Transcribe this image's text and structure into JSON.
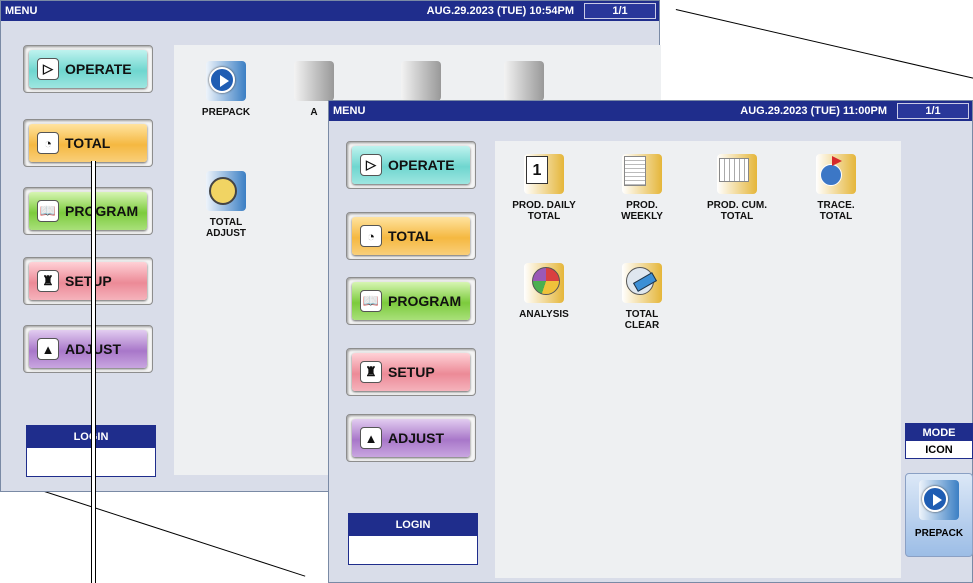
{
  "back_screen": {
    "menu_label": "MENU",
    "datetime": "AUG.29.2023 (TUE) 10:54PM",
    "page": "1/1",
    "nav": [
      {
        "label": "OPERATE",
        "icon": "operate-icon"
      },
      {
        "label": "TOTAL",
        "icon": "total-icon"
      },
      {
        "label": "PROGRAM",
        "icon": "program-icon"
      },
      {
        "label": "SETUP",
        "icon": "setup-icon"
      },
      {
        "label": "ADJUST",
        "icon": "adjust-icon"
      }
    ],
    "login_label": "LOGIN",
    "tiles": [
      {
        "label": "PREPACK",
        "icon": "prepack-icon"
      },
      {
        "label": "A",
        "icon": "trash-icon"
      },
      {
        "label": "TOTAL ADJUST",
        "icon": "total-adjust-icon"
      }
    ]
  },
  "front_screen": {
    "menu_label": "MENU",
    "datetime": "AUG.29.2023 (TUE) 11:00PM",
    "page": "1/1",
    "nav": [
      {
        "label": "OPERATE",
        "icon": "operate-icon"
      },
      {
        "label": "TOTAL",
        "icon": "total-icon"
      },
      {
        "label": "PROGRAM",
        "icon": "program-icon"
      },
      {
        "label": "SETUP",
        "icon": "setup-icon"
      },
      {
        "label": "ADJUST",
        "icon": "adjust-icon"
      }
    ],
    "login_label": "LOGIN",
    "tiles": [
      {
        "label": "PROD. DAILY TOTAL",
        "icon": "calendar-icon"
      },
      {
        "label": "PROD. WEEKLY",
        "icon": "document-icon"
      },
      {
        "label": "PROD. CUM. TOTAL",
        "icon": "spreadsheet-icon"
      },
      {
        "label": "TRACE. TOTAL",
        "icon": "globe-flag-icon"
      },
      {
        "label": "ANALYSIS",
        "icon": "pie-chart-icon"
      },
      {
        "label": "TOTAL CLEAR",
        "icon": "eraser-icon"
      }
    ],
    "mode_label": "MODE",
    "mode_value": "ICON",
    "prepack_label": "PREPACK"
  }
}
